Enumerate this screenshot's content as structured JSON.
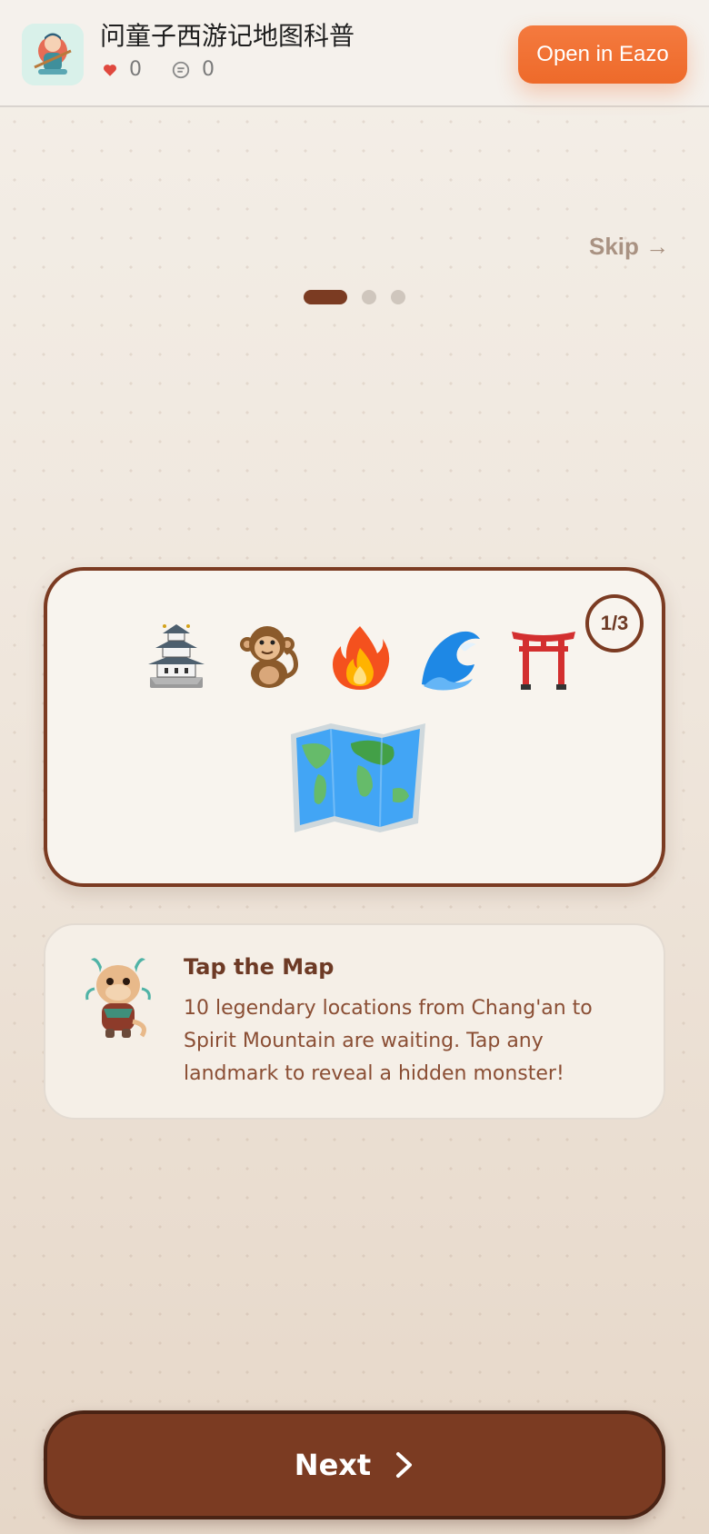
{
  "header": {
    "app_title": "问童子西游记地图科普",
    "likes_count": "0",
    "comments_count": "0",
    "open_button": "Open in Eazo"
  },
  "onboarding": {
    "skip_label": "Skip →",
    "page_current": 1,
    "page_total": 3,
    "counter_text": "1/3",
    "emojis": [
      "🏯",
      "🐒",
      "🔥",
      "🌊",
      "⛩️",
      "🗺️"
    ],
    "tip_title": "Tap the Map",
    "tip_body": "10 legendary locations from Chang'an to Spirit Mountain are waiting. Tap any landmark to reveal a hidden monster!",
    "next_label": "Next"
  },
  "colors": {
    "accent_orange": "#ee6a2a",
    "brand_brown": "#7b3b22",
    "inactive_dot": "#cfc6bd",
    "like_red": "#e0483e"
  }
}
